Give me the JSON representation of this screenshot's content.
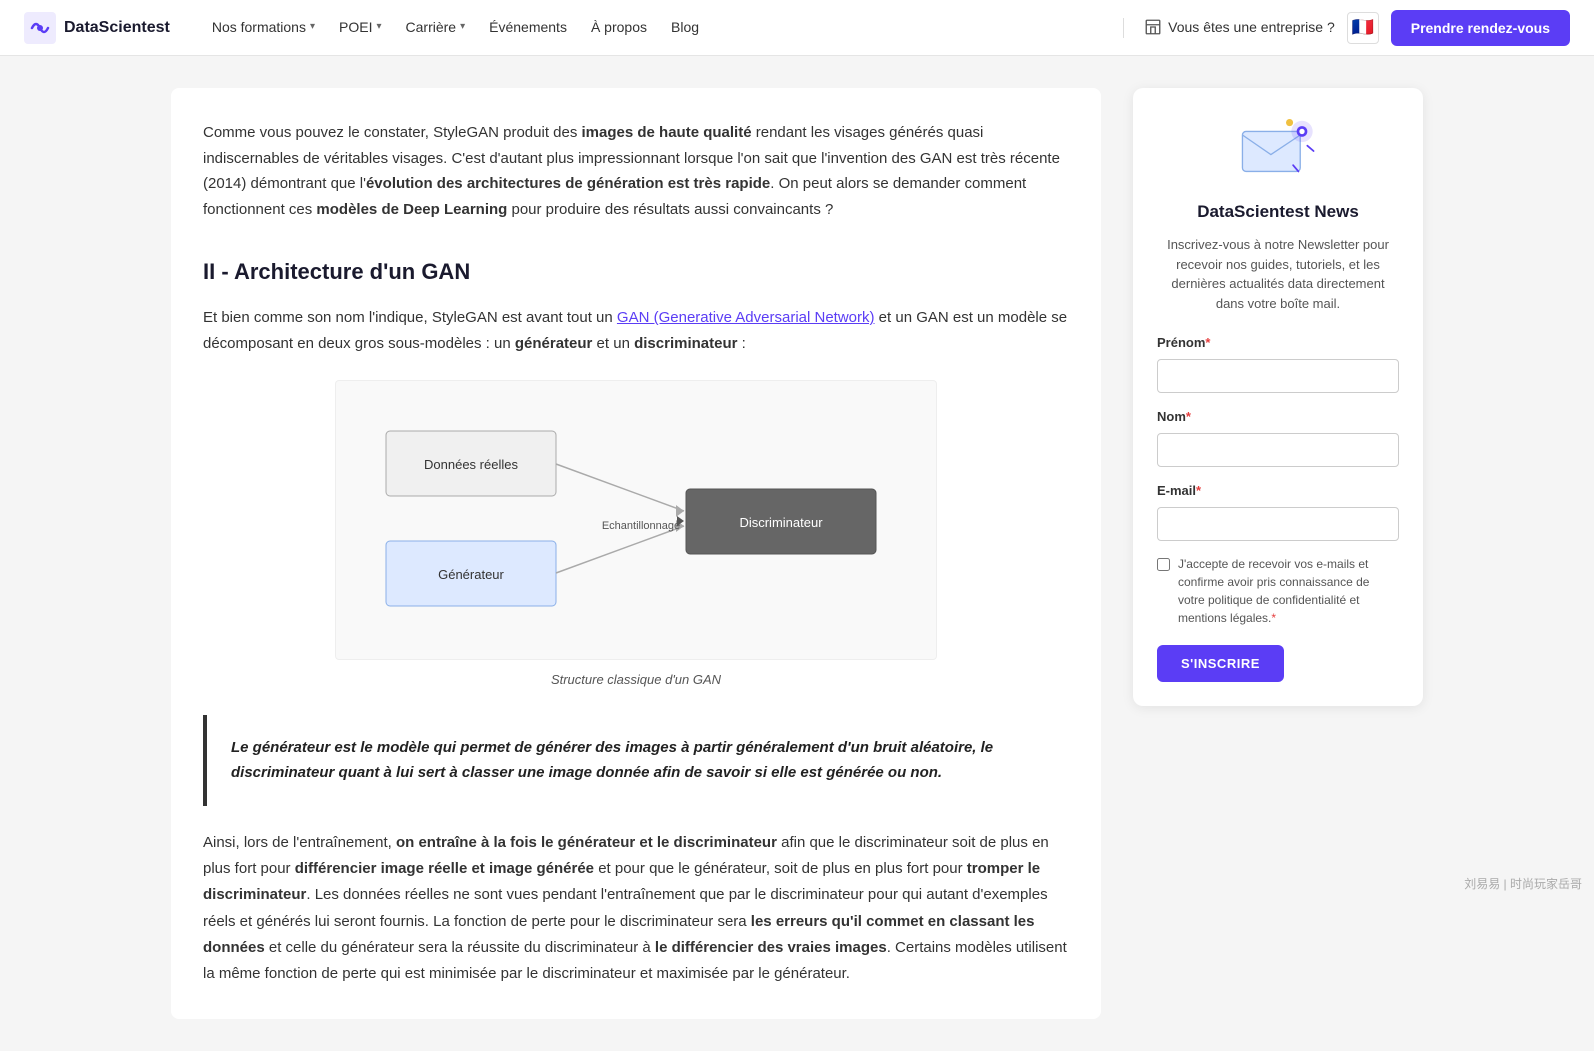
{
  "nav": {
    "logo_text": "DataScientest",
    "links": [
      {
        "label": "Nos formations",
        "has_dropdown": true
      },
      {
        "label": "POEI",
        "has_dropdown": true
      },
      {
        "label": "Carrière",
        "has_dropdown": true
      },
      {
        "label": "Événements",
        "has_dropdown": false
      },
      {
        "label": "À propos",
        "has_dropdown": false
      },
      {
        "label": "Blog",
        "has_dropdown": false
      }
    ],
    "enterprise_label": "Vous êtes une entreprise ?",
    "cta_label": "Prendre rendez-vous"
  },
  "article": {
    "intro_paragraph": "Comme vous pouvez le constater, StyleGAN produit des images de haute qualité rendant les visages générés quasi indiscernables de véritables visages. C'est d'autant plus impressionnant lorsque l'on sait que l'invention des GAN est très récente (2014) démontrant que l'évolution des architectures de génération est très rapide. On peut alors se demander comment fonctionnent ces modèles de Deep Learning pour produire des résultats aussi convaincants ?",
    "section_title": "II - Architecture d'un GAN",
    "section_intro_part1": "Et bien comme son nom l'indique, StyleGAN est avant tout un ",
    "section_link": "GAN (Generative Adversarial Network)",
    "section_intro_part2": " et un GAN est un modèle se décomposant en deux gros sous-modèles : un ",
    "section_bold1": "générateur",
    "section_intro_part3": " et un ",
    "section_bold2": "discriminateur",
    "section_intro_part4": " :",
    "diagram_caption": "Structure classique d'un GAN",
    "diagram": {
      "box_donnees": "Données réelles",
      "box_generateur": "Générateur",
      "label_echantillonnage": "Echantillonnage",
      "box_discriminateur": "Discriminateur"
    },
    "highlight_text": "Le générateur est le modèle qui permet de générer des images à partir généralement d'un bruit aléatoire, le discriminateur quant à lui sert à classer une image donnée afin de savoir si elle est générée ou non.",
    "body_paragraph": "Ainsi, lors de l'entraînement, on entraîne à la fois le générateur et le discriminateur afin que le discriminateur soit de plus en plus fort pour différencier image réelle et image générée et pour que le générateur, soit de plus en plus fort pour tromper le discriminateur. Les données réelles ne sont vues pendant l'entraînement que par le discriminateur pour qui autant d'exemples réels et générés lui seront fournis. La fonction de perte pour le discriminateur sera les erreurs qu'il commet en classant les données et celle du générateur sera la réussite du discriminateur à le différencier des vraies images. Certains modèles utilisent la même fonction de perte qui est minimisée par le discriminateur et maximisée par le générateur."
  },
  "sidebar": {
    "newsletter_title": "DataScientest News",
    "newsletter_desc": "Inscrivez-vous à notre Newsletter pour recevoir nos guides, tutoriels, et les dernières actualités data directement dans votre boîte mail.",
    "field_prenom_label": "Prénom",
    "field_nom_label": "Nom",
    "field_email_label": "E-mail",
    "checkbox_label": "J'accepte de recevoir vos e-mails et confirme avoir pris connaissance de votre politique de confidentialité et mentions légales.",
    "subscribe_btn": "S'INSCRIRE"
  },
  "watermark": "刘易易 | 时尚玩家岳哥"
}
